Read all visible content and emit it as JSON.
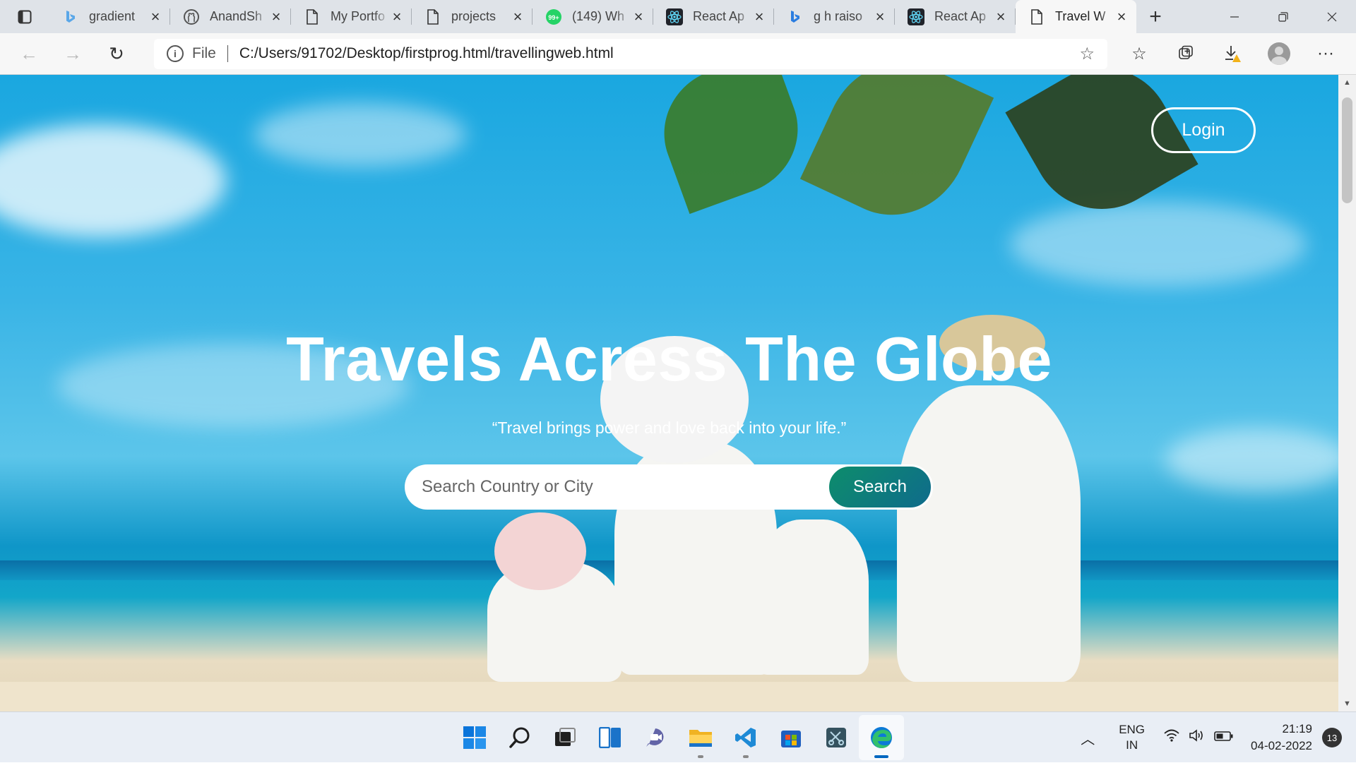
{
  "browser": {
    "tabs": [
      {
        "title": "gradient",
        "icon": "bing-icon",
        "active": false
      },
      {
        "title": "AnandSh",
        "icon": "github-icon",
        "active": false
      },
      {
        "title": "My Portfo",
        "icon": "file-icon",
        "active": false
      },
      {
        "title": "projects",
        "icon": "file-icon",
        "active": false
      },
      {
        "title": "(149) Wh",
        "icon": "whatsapp-icon",
        "badge": "99+",
        "active": false
      },
      {
        "title": "React Ap",
        "icon": "react-icon",
        "active": false
      },
      {
        "title": "g h raiso",
        "icon": "bing-icon",
        "active": false
      },
      {
        "title": "React Ap",
        "icon": "react-icon",
        "active": false
      },
      {
        "title": "Travel W",
        "icon": "file-icon",
        "active": true
      }
    ],
    "address": {
      "scheme": "File",
      "url": "C:/Users/91702/Desktop/firstprog.html/travellingweb.html"
    }
  },
  "page": {
    "login_label": "Login",
    "title": "Travels Acress The Globe",
    "quote": "“Travel brings power and love back into your life.”",
    "search": {
      "placeholder": "Search Country or City",
      "value": "",
      "button_label": "Search"
    }
  },
  "taskbar": {
    "apps": [
      "windows-start-icon",
      "search-icon",
      "task-view-icon",
      "widgets-icon",
      "chat-icon",
      "file-explorer-icon",
      "vscode-icon",
      "store-icon",
      "snipping-tool-icon",
      "edge-icon"
    ],
    "language": {
      "line1": "ENG",
      "line2": "IN"
    },
    "time": "21:19",
    "date": "04-02-2022",
    "notification_count": "13"
  },
  "colors": {
    "search_button_gradient": [
      "#0d8d6b",
      "#0f6b8c"
    ],
    "sky": "#1aa7e0"
  }
}
